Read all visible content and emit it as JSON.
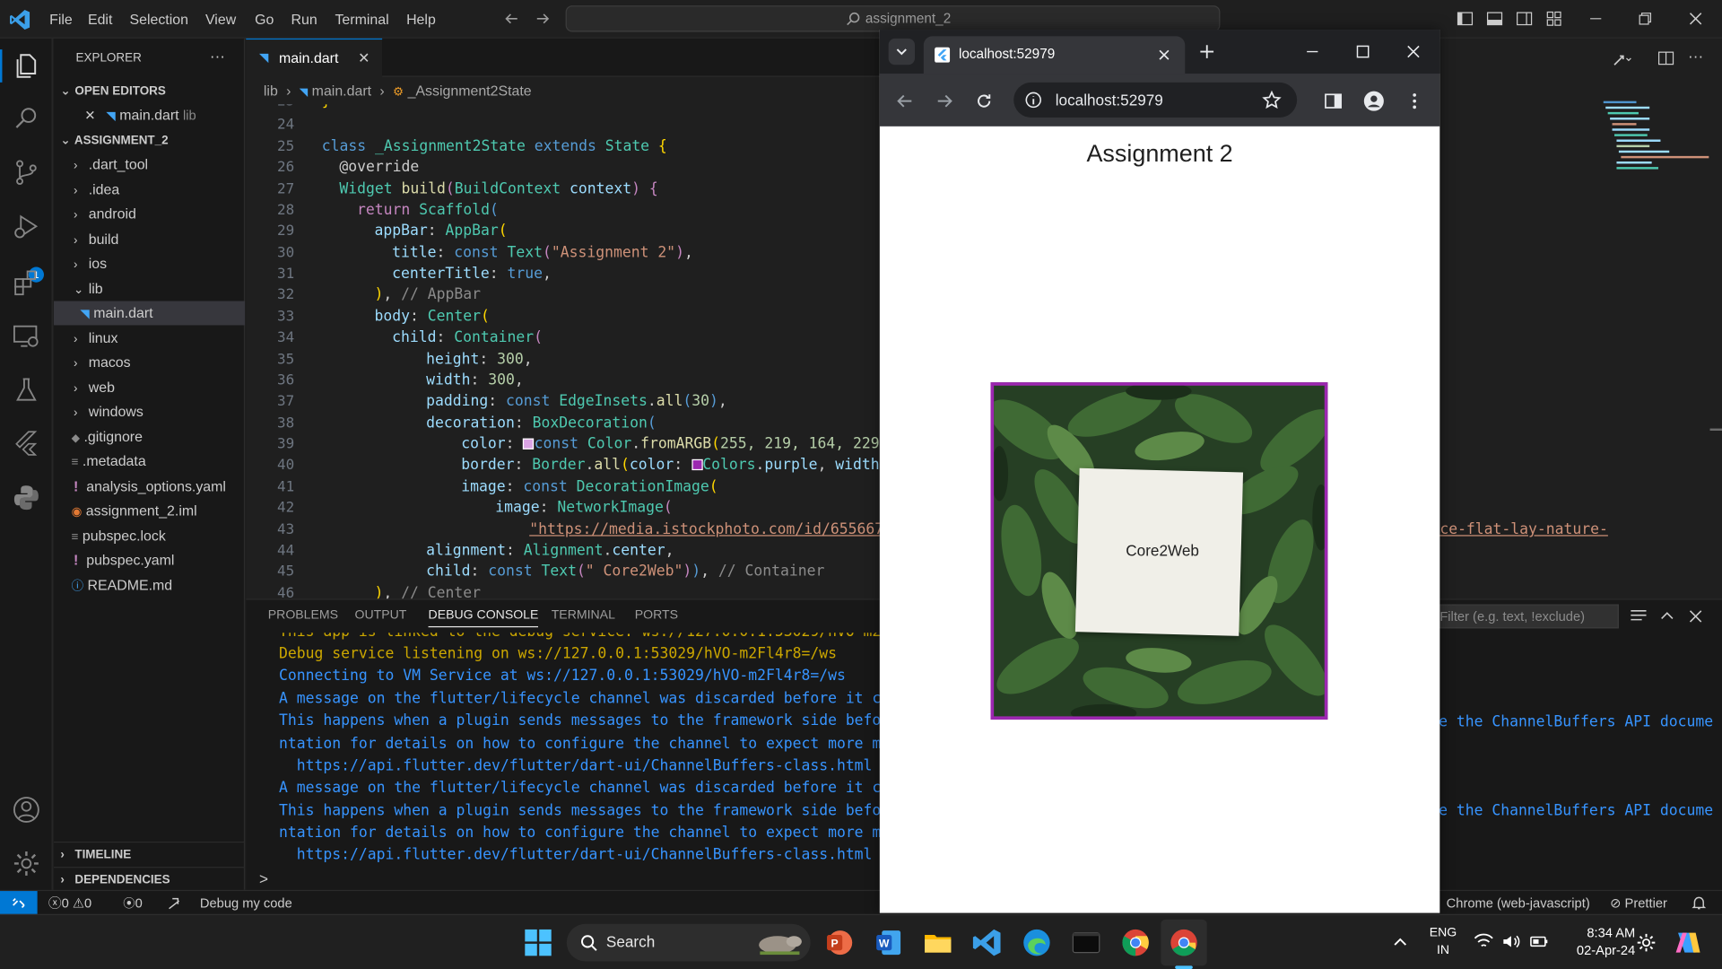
{
  "titlebar": {
    "menus": [
      "File",
      "Edit",
      "Selection",
      "View",
      "Go",
      "Run",
      "Terminal",
      "Help"
    ],
    "search_text": "assignment_2"
  },
  "sidebar": {
    "title": "EXPLORER",
    "more": "···",
    "open_editors": "OPEN EDITORS",
    "open_file": "main.dart",
    "open_file_dir": "lib",
    "project": "ASSIGNMENT_2",
    "items": [
      ".dart_tool",
      ".idea",
      "android",
      "build",
      "ios",
      "lib",
      "main.dart",
      "linux",
      "macos",
      "web",
      "windows",
      ".gitignore",
      ".metadata",
      "analysis_options.yaml",
      "assignment_2.iml",
      "pubspec.lock",
      "pubspec.yaml",
      "README.md"
    ],
    "timeline": "TIMELINE",
    "dependencies": "DEPENDENCIES"
  },
  "activity": {
    "run_badge": "1"
  },
  "editor": {
    "tab_label": "main.dart",
    "breadcrumb": {
      "folder": "lib",
      "file": "main.dart",
      "symbol": "_Assignment2State"
    },
    "line_numbers": [
      "23",
      "24",
      "25",
      "26",
      "27",
      "28",
      "29",
      "30",
      "31",
      "32",
      "33",
      "34",
      "35",
      "36",
      "37",
      "38",
      "39",
      "40",
      "41",
      "42",
      "43",
      "44",
      "45",
      "46"
    ],
    "code": {
      "l23": "}",
      "l25_class": "class",
      "l25_name": "_Assignment2State",
      "l25_ext": "extends",
      "l25_state": "State",
      "l26": "@override",
      "l27_type": "Widget",
      "l27_fn": "build",
      "l27_arg": "BuildContext",
      "l27_ctx": "context",
      "l28_ret": "return",
      "l28_w": "Scaffold",
      "l29_prop": "appBar",
      "l29_w": "AppBar",
      "l30_prop": "title",
      "l30_kw": "const",
      "l30_w": "Text",
      "l30_str": "\"Assignment 2\"",
      "l31_prop": "centerTitle",
      "l31_val": "true",
      "l32_cm": "// AppBar",
      "l33_prop": "body",
      "l33_w": "Center",
      "l34_prop": "child",
      "l34_w": "Container",
      "l35_prop": "height",
      "l35_val": "300",
      "l36_prop": "width",
      "l36_val": "300",
      "l37_prop": "padding",
      "l37_kw": "const",
      "l37_w": "EdgeInsets",
      "l37_fn": "all",
      "l37_val": "30",
      "l38_prop": "decoration",
      "l38_w": "BoxDecoration",
      "l39_prop": "color",
      "l39_kw": "const",
      "l39_w": "Color",
      "l39_fn": "fromARGB",
      "l39_val": "255, 219, 164, 229",
      "l40_prop": "border",
      "l40_w": "Border",
      "l40_fn": "all",
      "l40_cprop": "color",
      "l40_cls": "Colors",
      "l40_val": "purple",
      "l40_rest": "width",
      "l41_prop": "image",
      "l41_kw": "const",
      "l41_w": "DecorationImage",
      "l42_prop": "image",
      "l42_w": "NetworkImage",
      "l43_str": "\"https://media.istockphoto.com/id/6556672",
      "l43_tail": "ce-flat-lay-nature-",
      "l44_prop": "alignment",
      "l44_w": "Alignment",
      "l44_val": "center",
      "l45_prop": "child",
      "l45_kw": "const",
      "l45_w": "Text",
      "l45_str": "\" Core2Web\"",
      "l45_cm": "// Container",
      "l46_cm": "// Center"
    },
    "swatch_color_1": "#dba4e5",
    "swatch_color_2": "#9c27b0"
  },
  "panel": {
    "tabs": [
      "PROBLEMS",
      "OUTPUT",
      "DEBUG CONSOLE",
      "TERMINAL",
      "PORTS"
    ],
    "active_tab": "DEBUG CONSOLE",
    "filter_placeholder": "Filter (e.g. text, !exclude)",
    "lines": [
      {
        "text": "This app is linked to the debug service: ws://127.0.0.1:53029/hVO-m2Fl",
        "color": "#cca700"
      },
      {
        "text": "Debug service listening on ws://127.0.0.1:53029/hVO-m2Fl4r8=/ws",
        "color": "#cca700"
      },
      {
        "text": "Connecting to VM Service at ws://127.0.0.1:53029/hVO-m2Fl4r8=/ws",
        "color": "#3794ff"
      },
      {
        "text": "A message on the flutter/lifecycle channel was discarded before it cou",
        "color": "#3794ff"
      },
      {
        "text": "This happens when a plugin sends messages to the framework side before",
        "color": "#3794ff"
      },
      {
        "text": "ntation for details on how to configure the channel to expect more mes",
        "color": "#3794ff"
      },
      {
        "text": "  https://api.flutter.dev/flutter/dart-ui/ChannelBuffers-class.html",
        "color": "#3794ff"
      },
      {
        "text": "A message on the flutter/lifecycle channel was discarded before it cou",
        "color": "#3794ff"
      },
      {
        "text": "This happens when a plugin sends messages to the framework side before",
        "color": "#3794ff"
      },
      {
        "text": "ntation for details on how to configure the channel to expect more mes",
        "color": "#3794ff"
      },
      {
        "text": "  https://api.flutter.dev/flutter/dart-ui/ChannelBuffers-class.html",
        "color": "#3794ff"
      }
    ],
    "right_fragment": "e the ChannelBuffers API docume",
    "prompt": ">"
  },
  "statusbar": {
    "errors": "0",
    "warnings": "0",
    "ports": "0",
    "debug": "Debug my code",
    "target": "Chrome (web-javascript)",
    "prettier": "Prettier"
  },
  "browser": {
    "tab_title": "localhost:52979",
    "address": "localhost:52979",
    "app_title": "Assignment 2",
    "card_text": "Core2Web",
    "border_color": "#9c27b0"
  },
  "taskbar": {
    "search": "Search",
    "lang_top": "ENG",
    "lang_bottom": "IN",
    "time": "8:34 AM",
    "date": "02-Apr-24"
  }
}
